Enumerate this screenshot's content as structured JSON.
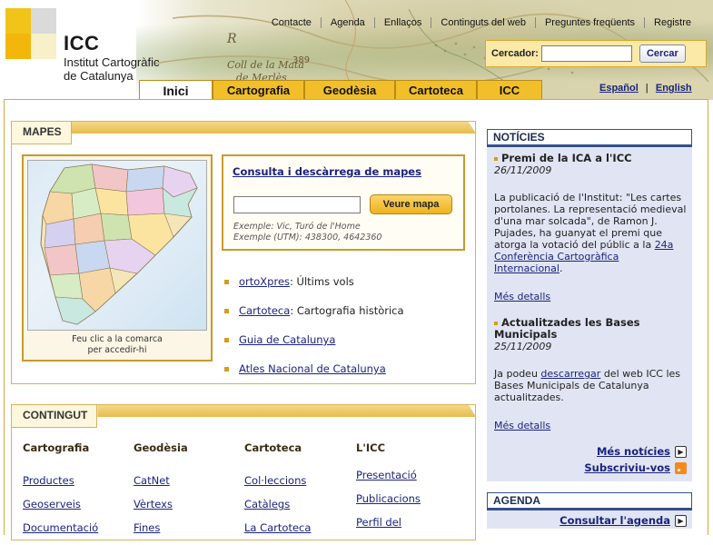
{
  "logo": {
    "title": "ICC",
    "subtitle_line1": "Institut Cartogràfic",
    "subtitle_line2": "de Catalunya",
    "colors": [
      "#f0c419",
      "#d9d9d9",
      "#f3b70c"
    ]
  },
  "banner": {
    "map_labels": [
      "Coll de la Mata",
      "389",
      "de Merlès",
      "R"
    ]
  },
  "top_nav": [
    "Contacte",
    "Agenda",
    "Enllaços",
    "Continguts del web",
    "Preguntes freqüents",
    "Registre"
  ],
  "search": {
    "label": "Cercador:",
    "value": "",
    "button": "Cercar"
  },
  "languages": {
    "spanish": "Español",
    "separator": "|",
    "english": "English"
  },
  "tabs": [
    {
      "label": "Inici",
      "active": true
    },
    {
      "label": "Cartografia",
      "active": false
    },
    {
      "label": "Geodèsia",
      "active": false
    },
    {
      "label": "Cartoteca",
      "active": false
    },
    {
      "label": "ICC",
      "active": false
    }
  ],
  "mapes": {
    "title": "MAPES",
    "map_caption_line1": "Feu clic a la comarca",
    "map_caption_line2": "per accedir-hi",
    "consulta": {
      "title": "Consulta i descàrrega de mapes",
      "input_value": "",
      "button": "Veure mapa",
      "example1": "Exemple: Vic, Turó de l'Home",
      "example2": "Exemple (UTM): 438300, 4642360"
    },
    "links": [
      {
        "link": "ortoXpres",
        "text": ": Últims vols"
      },
      {
        "link": "Cartoteca",
        "text": ": Cartografia històrica"
      },
      {
        "link": "Guia de Catalunya",
        "text": ""
      },
      {
        "link": "Atles Nacional de Catalunya",
        "text": ""
      }
    ]
  },
  "contingut": {
    "title": "CONTINGUT",
    "columns": [
      {
        "head": "Cartografia",
        "items": [
          "Productes",
          "Geoserveis",
          "Documentació"
        ]
      },
      {
        "head": "Geodèsia",
        "items": [
          "CatNet",
          "Vèrtexs",
          "Fines"
        ]
      },
      {
        "head": "Cartoteca",
        "items": [
          "Col·leccions",
          "Catàlegs",
          "La Cartoteca"
        ]
      },
      {
        "head": "L'ICC",
        "items": [
          "Presentació",
          "Publicacions",
          "Perfil del"
        ]
      }
    ]
  },
  "noticies": {
    "title": "NOTÍCIES",
    "items": [
      {
        "title": "Premi de la ICA a l'ICC",
        "date": "26/11/2009",
        "body_before": "La publicació de l'Institut: \"Les cartes portolanes. La representació medieval d'una mar solcada\", de Ramon J. Pujades, ha guanyat el premi que atorga la votació del públic a la ",
        "body_link": "24a Conferència Cartogràfica Internacional",
        "body_after": ".",
        "more": "Més detalls"
      },
      {
        "title": "Actualitzades les Bases Municipals",
        "date": "25/11/2009",
        "body_before": "Ja podeu ",
        "body_link": "descarregar",
        "body_after": " del web ICC les Bases Municipals de Catalunya actualitzades.",
        "more": "Més detalls"
      }
    ],
    "more_news": "Més notícies",
    "subscribe": "Subscriviu-vos"
  },
  "agenda": {
    "title": "AGENDA",
    "link": "Consultar l'agenda"
  }
}
